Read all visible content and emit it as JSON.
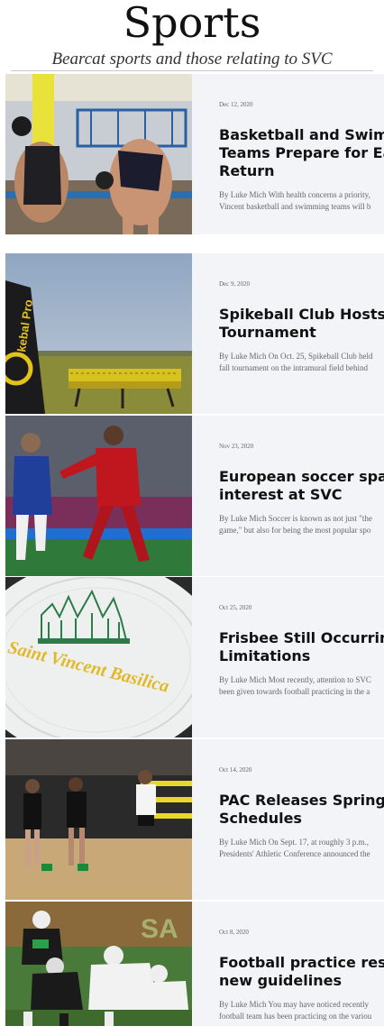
{
  "header": {
    "title": "Sports",
    "subtitle": "Bearcat sports and those relating to SVC"
  },
  "articles": [
    {
      "date": "Dec 12, 2020",
      "headline_lines": [
        "Basketball and Swimmin",
        "Teams Prepare for Early",
        "Return"
      ],
      "excerpt_lines": [
        "By Luke Mich With health concerns a priority,",
        "Vincent basketball and swimming teams will b"
      ],
      "image": "swimmers-on-starting-blocks"
    },
    {
      "date": "Dec 9, 2020",
      "headline_lines": [
        "Spikeball Club Hosts An",
        "Tournament"
      ],
      "excerpt_lines": [
        "By Luke Mich On Oct. 25, Spikeball Club held",
        "fall tournament on the intramural field behind"
      ],
      "image": "spikeball-net-on-grass",
      "image_text": "kebal Pro"
    },
    {
      "date": "Nov 23, 2020",
      "headline_lines": [
        "European soccer sparks",
        "interest at SVC"
      ],
      "excerpt_lines": [
        "By Luke Mich Soccer is known as not just \"the",
        "game,\" but also for being the most popular spo"
      ],
      "image": "soccer-players-blue-and-red"
    },
    {
      "date": "Oct 25, 2020",
      "headline_lines": [
        "Frisbee Still Occurring D",
        "Limitations"
      ],
      "excerpt_lines": [
        "By Luke Mich Most recently, attention to SVC",
        "been given towards football practicing in the a"
      ],
      "image": "saint-vincent-basilica-frisbee",
      "image_text": "Saint Vincent Basilica"
    },
    {
      "date": "Oct 14, 2020",
      "headline_lines": [
        "PAC Releases Spring",
        "Schedules"
      ],
      "excerpt_lines": [
        "By Luke Mich On Sept. 17, at roughly 3 p.m.,",
        "Presidents' Athletic Conference announced the"
      ],
      "image": "volleyball-team-in-gym"
    },
    {
      "date": "Oct 8, 2020",
      "headline_lines": [
        "Football practice resume",
        "new guidelines"
      ],
      "excerpt_lines": [
        "By Luke Mich You may have noticed recently",
        "football team has been practicing on the variou"
      ],
      "image": "football-lineup-practice",
      "image_text": "SA"
    }
  ],
  "colors": {
    "card_bg": "#f2f4f7",
    "headline": "#111111",
    "excerpt": "#666666"
  }
}
